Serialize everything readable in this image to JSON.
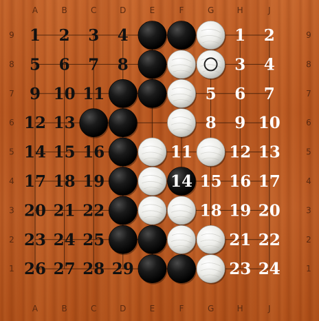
{
  "columns": [
    "A",
    "B",
    "C",
    "D",
    "E",
    "F",
    "G",
    "H",
    "J"
  ],
  "rows": [
    "9",
    "8",
    "7",
    "6",
    "5",
    "4",
    "3",
    "2",
    "1"
  ],
  "colors": {
    "grid_line": "#3a1a08",
    "black_stone": "#101010",
    "white_stone": "#f2f2ee",
    "black_label": "#111111",
    "white_label": "#ffffff"
  },
  "stones": [
    {
      "col": "E",
      "row": "9",
      "color": "black"
    },
    {
      "col": "F",
      "row": "9",
      "color": "black"
    },
    {
      "col": "G",
      "row": "9",
      "color": "white"
    },
    {
      "col": "E",
      "row": "8",
      "color": "black"
    },
    {
      "col": "F",
      "row": "8",
      "color": "white"
    },
    {
      "col": "G",
      "row": "8",
      "color": "white",
      "last_move": true
    },
    {
      "col": "D",
      "row": "7",
      "color": "black"
    },
    {
      "col": "E",
      "row": "7",
      "color": "black"
    },
    {
      "col": "F",
      "row": "7",
      "color": "white"
    },
    {
      "col": "C",
      "row": "6",
      "color": "black"
    },
    {
      "col": "D",
      "row": "6",
      "color": "black"
    },
    {
      "col": "F",
      "row": "6",
      "color": "white"
    },
    {
      "col": "D",
      "row": "5",
      "color": "black"
    },
    {
      "col": "E",
      "row": "5",
      "color": "white"
    },
    {
      "col": "G",
      "row": "5",
      "color": "white"
    },
    {
      "col": "D",
      "row": "4",
      "color": "black"
    },
    {
      "col": "E",
      "row": "4",
      "color": "white"
    },
    {
      "col": "F",
      "row": "4",
      "color": "black",
      "label": "14"
    },
    {
      "col": "D",
      "row": "3",
      "color": "black"
    },
    {
      "col": "E",
      "row": "3",
      "color": "white"
    },
    {
      "col": "F",
      "row": "3",
      "color": "white"
    },
    {
      "col": "D",
      "row": "2",
      "color": "black"
    },
    {
      "col": "E",
      "row": "2",
      "color": "black"
    },
    {
      "col": "F",
      "row": "2",
      "color": "white"
    },
    {
      "col": "G",
      "row": "2",
      "color": "white"
    },
    {
      "col": "E",
      "row": "1",
      "color": "black"
    },
    {
      "col": "F",
      "row": "1",
      "color": "black"
    },
    {
      "col": "G",
      "row": "1",
      "color": "white"
    }
  ],
  "black_territory_labels": [
    {
      "col": "A",
      "row": "9",
      "text": "1"
    },
    {
      "col": "B",
      "row": "9",
      "text": "2"
    },
    {
      "col": "C",
      "row": "9",
      "text": "3"
    },
    {
      "col": "D",
      "row": "9",
      "text": "4"
    },
    {
      "col": "A",
      "row": "8",
      "text": "5"
    },
    {
      "col": "B",
      "row": "8",
      "text": "6"
    },
    {
      "col": "C",
      "row": "8",
      "text": "7"
    },
    {
      "col": "D",
      "row": "8",
      "text": "8"
    },
    {
      "col": "A",
      "row": "7",
      "text": "9"
    },
    {
      "col": "B",
      "row": "7",
      "text": "10"
    },
    {
      "col": "C",
      "row": "7",
      "text": "11"
    },
    {
      "col": "A",
      "row": "6",
      "text": "12"
    },
    {
      "col": "B",
      "row": "6",
      "text": "13"
    },
    {
      "col": "A",
      "row": "5",
      "text": "14"
    },
    {
      "col": "B",
      "row": "5",
      "text": "15"
    },
    {
      "col": "C",
      "row": "5",
      "text": "16"
    },
    {
      "col": "A",
      "row": "4",
      "text": "17"
    },
    {
      "col": "B",
      "row": "4",
      "text": "18"
    },
    {
      "col": "C",
      "row": "4",
      "text": "19"
    },
    {
      "col": "A",
      "row": "3",
      "text": "20"
    },
    {
      "col": "B",
      "row": "3",
      "text": "21"
    },
    {
      "col": "C",
      "row": "3",
      "text": "22"
    },
    {
      "col": "A",
      "row": "2",
      "text": "23"
    },
    {
      "col": "B",
      "row": "2",
      "text": "24"
    },
    {
      "col": "C",
      "row": "2",
      "text": "25"
    },
    {
      "col": "A",
      "row": "1",
      "text": "26"
    },
    {
      "col": "B",
      "row": "1",
      "text": "27"
    },
    {
      "col": "C",
      "row": "1",
      "text": "28"
    },
    {
      "col": "D",
      "row": "1",
      "text": "29"
    }
  ],
  "white_territory_labels": [
    {
      "col": "H",
      "row": "9",
      "text": "1"
    },
    {
      "col": "J",
      "row": "9",
      "text": "2"
    },
    {
      "col": "H",
      "row": "8",
      "text": "3"
    },
    {
      "col": "J",
      "row": "8",
      "text": "4"
    },
    {
      "col": "G",
      "row": "7",
      "text": "5"
    },
    {
      "col": "H",
      "row": "7",
      "text": "6"
    },
    {
      "col": "J",
      "row": "7",
      "text": "7"
    },
    {
      "col": "G",
      "row": "6",
      "text": "8"
    },
    {
      "col": "H",
      "row": "6",
      "text": "9"
    },
    {
      "col": "J",
      "row": "6",
      "text": "10"
    },
    {
      "col": "F",
      "row": "5",
      "text": "11"
    },
    {
      "col": "H",
      "row": "5",
      "text": "12"
    },
    {
      "col": "J",
      "row": "5",
      "text": "13"
    },
    {
      "col": "G",
      "row": "4",
      "text": "15"
    },
    {
      "col": "H",
      "row": "4",
      "text": "16"
    },
    {
      "col": "J",
      "row": "4",
      "text": "17"
    },
    {
      "col": "G",
      "row": "3",
      "text": "18"
    },
    {
      "col": "H",
      "row": "3",
      "text": "19"
    },
    {
      "col": "J",
      "row": "3",
      "text": "20"
    },
    {
      "col": "H",
      "row": "2",
      "text": "21"
    },
    {
      "col": "J",
      "row": "2",
      "text": "22"
    },
    {
      "col": "H",
      "row": "1",
      "text": "23"
    },
    {
      "col": "J",
      "row": "1",
      "text": "24"
    }
  ]
}
